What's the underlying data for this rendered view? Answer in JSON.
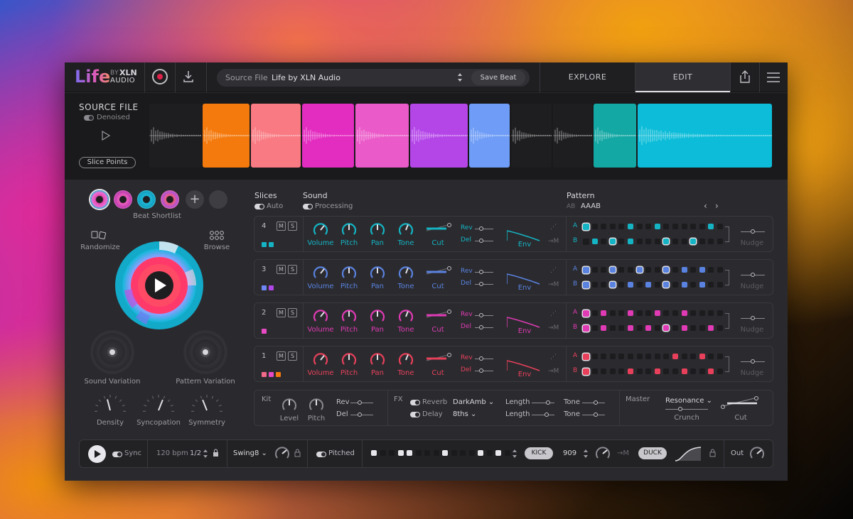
{
  "header": {
    "logo_main": "Life",
    "logo_by": "BY",
    "logo_brand": "XLN",
    "logo_audio": "AUDIO",
    "source_label": "Source File",
    "source_value": "Life by XLN Audio",
    "save_label": "Save Beat",
    "tabs": [
      "EXPLORE",
      "EDIT"
    ],
    "active_tab": "EDIT",
    "icons": [
      "record-icon",
      "download-icon",
      "share-icon",
      "menu-icon"
    ]
  },
  "source_panel": {
    "title": "SOURCE FILE",
    "denoised_label": "Denoised",
    "slice_points_label": "Slice Points",
    "slice_colors": [
      "#1e1e20",
      "#f47a0e",
      "#f97a82",
      "#e32cc0",
      "#ea5ac8",
      "#b446e8",
      "#6e9cf6",
      "#1e1e20",
      "#1e1e20",
      "#14a8a4",
      "#0cbcd8"
    ]
  },
  "left": {
    "beat_shortlist_label": "Beat Shortlist",
    "randomize_label": "Randomize",
    "browse_label": "Browse",
    "sound_variation_label": "Sound Variation",
    "pattern_variation_label": "Pattern Variation",
    "knobs": [
      "Density",
      "Syncopation",
      "Symmetry"
    ]
  },
  "sections": {
    "slices_label": "Slices",
    "slices_auto": "Auto",
    "sound_label": "Sound",
    "sound_processing": "Processing",
    "pattern_label": "Pattern",
    "pattern_ab": "AB",
    "pattern_value": "AAAB"
  },
  "track_labels": {
    "volume": "Volume",
    "pitch": "Pitch",
    "pan": "Pan",
    "tone": "Tone",
    "cut": "Cut",
    "rev": "Rev",
    "del": "Del",
    "env": "Env",
    "to_m": "→M",
    "nudge": "Nudge",
    "mute": "M",
    "solo": "S",
    "row_a": "A",
    "row_b": "B"
  },
  "tracks": [
    {
      "number": "4",
      "color": "#14b4c4",
      "swatches": [
        "#14b4c4",
        "#14b4c4"
      ],
      "a_active": [
        0,
        5,
        8,
        14
      ],
      "b_active": [
        1,
        3,
        5,
        9,
        12
      ]
    },
    {
      "number": "3",
      "color": "#5a82e0",
      "swatches": [
        "#6e86f2",
        "#b046e8"
      ],
      "a_active": [
        0,
        3,
        6,
        9,
        11,
        13
      ],
      "b_active": [
        0,
        3,
        5,
        7,
        9,
        11,
        13
      ]
    },
    {
      "number": "2",
      "color": "#e03ab4",
      "swatches": [
        "#e84ac4"
      ],
      "a_active": [
        0,
        2,
        5,
        8,
        11
      ],
      "b_active": [
        0,
        2,
        5,
        7,
        9,
        11,
        14
      ]
    },
    {
      "number": "1",
      "color": "#e8405a",
      "swatches": [
        "#f26a8a",
        "#e84ac4",
        "#f47a0e"
      ],
      "a_active": [
        0,
        10,
        13
      ],
      "b_active": [
        0,
        5,
        8,
        11,
        14
      ]
    }
  ],
  "kit": {
    "label": "Kit",
    "level": "Level",
    "pitch": "Pitch",
    "rev": "Rev",
    "del": "Del"
  },
  "fx": {
    "label": "FX",
    "reverb": "Reverb",
    "reverb_type": "DarkAmb",
    "delay": "Delay",
    "delay_time": "8ths",
    "length": "Length",
    "tone": "Tone"
  },
  "master": {
    "label": "Master",
    "resonance": "Resonance",
    "crunch": "Crunch",
    "cut": "Cut"
  },
  "transport": {
    "sync": "Sync",
    "bpm": "120 bpm",
    "division": "1/2",
    "swing": "Swing8",
    "pitched": "Pitched",
    "kick": "KICK",
    "kick_value": "909",
    "to_m": "→M",
    "duck": "DUCK",
    "out": "Out",
    "steps_on": [
      0,
      3,
      4,
      8,
      12,
      14
    ]
  },
  "colors": {
    "accent": "#e0e0e4",
    "record": "#e0204a"
  }
}
